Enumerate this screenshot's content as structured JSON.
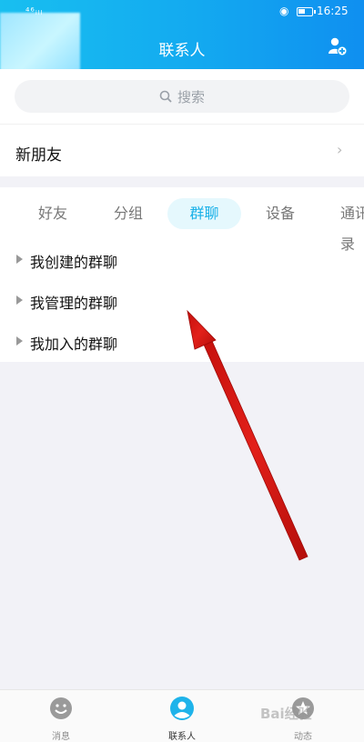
{
  "status_bar": {
    "signal": "⁴⁶ᵢₗₗ",
    "time": "16:25"
  },
  "header": {
    "title": "联系人"
  },
  "search": {
    "placeholder": "搜索"
  },
  "new_friends": {
    "label": "新朋友"
  },
  "tabs": [
    {
      "label": "好友",
      "active": false
    },
    {
      "label": "分组",
      "active": false
    },
    {
      "label": "群聊",
      "active": true
    },
    {
      "label": "设备",
      "active": false
    },
    {
      "label": "通讯录",
      "active": false
    }
  ],
  "groups": [
    {
      "label": "我创建的群聊"
    },
    {
      "label": "我管理的群聊"
    },
    {
      "label": "我加入的群聊"
    }
  ],
  "bottom_nav": [
    {
      "label": "消息",
      "icon": "smile-face-icon",
      "active": false
    },
    {
      "label": "联系人",
      "icon": "person-icon",
      "active": true
    },
    {
      "label": "动态",
      "icon": "star-icon",
      "active": false
    }
  ],
  "watermark": "Bai经验",
  "colors": {
    "header_start": "#18bff0",
    "header_end": "#0f8ff0",
    "accent": "#1ab1e8",
    "arrow": "#e2201a"
  }
}
